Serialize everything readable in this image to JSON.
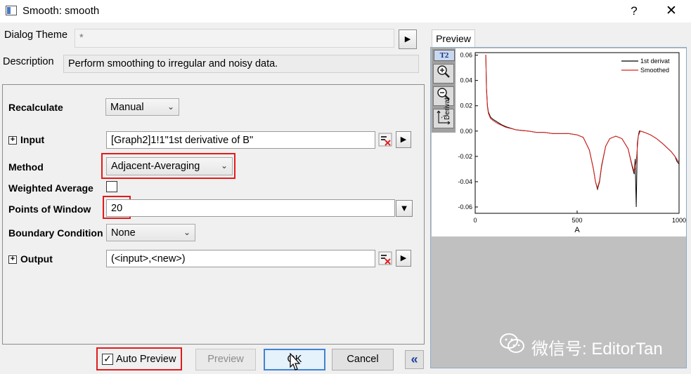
{
  "window": {
    "title": "Smooth: smooth",
    "help_label": "?",
    "close_label": "✕"
  },
  "header": {
    "theme_label": "Dialog Theme",
    "theme_value": "*",
    "description_label": "Description",
    "description_value": "Perform smoothing to irregular and noisy data."
  },
  "form": {
    "recalculate": {
      "label": "Recalculate",
      "value": "Manual"
    },
    "input": {
      "label": "Input",
      "value": "[Graph2]1!1\"1st derivative of B\""
    },
    "method": {
      "label": "Method",
      "value": "Adjacent-Averaging"
    },
    "weighted_average": {
      "label": "Weighted Average",
      "checked": false
    },
    "points_of_window": {
      "label": "Points of Window",
      "value": "20"
    },
    "boundary_condition": {
      "label": "Boundary Condition",
      "value": "None"
    },
    "output": {
      "label": "Output",
      "value": "(<input>,<new>)"
    }
  },
  "footer": {
    "auto_preview_label": "Auto Preview",
    "auto_preview_checked": true,
    "preview_button": "Preview",
    "ok_button": "OK",
    "cancel_button": "Cancel",
    "collapse_label": "«"
  },
  "preview": {
    "tab_label": "Preview",
    "layer_badge": "T2",
    "tools": [
      "zoom-in-icon",
      "zoom-out-icon",
      "rescale-icon"
    ]
  },
  "watermark": "微信号: EditorTan",
  "chart_data": {
    "type": "line",
    "xlabel": "A",
    "ylabel": "Derivat",
    "xlim": [
      0,
      1000
    ],
    "ylim": [
      -0.065,
      0.062
    ],
    "xticks": [
      "0",
      "500",
      "1000"
    ],
    "yticks": [
      "0.06",
      "0.04",
      "0.02",
      "0.00",
      "-0.02",
      "-0.04",
      "-0.06"
    ],
    "legend_position": "top-right",
    "series": [
      {
        "name": "1st derivat",
        "color": "#000000",
        "x": [
          50,
          52,
          55,
          60,
          65,
          75,
          90,
          110,
          130,
          150,
          180,
          200,
          230,
          260,
          300,
          340,
          380,
          420,
          460,
          500,
          530,
          560,
          580,
          590,
          600,
          610,
          620,
          640,
          660,
          690,
          720,
          750,
          770,
          780,
          785,
          790,
          795,
          800,
          805,
          810,
          830,
          860,
          890,
          920,
          940,
          960,
          980,
          990,
          1000
        ],
        "y": [
          0.06,
          0.06,
          0.035,
          0.02,
          0.015,
          0.011,
          0.009,
          0.007,
          0.005,
          0.0035,
          0.002,
          0.001,
          0.0005,
          0.0,
          -0.001,
          -0.001,
          -0.002,
          -0.002,
          -0.002,
          -0.003,
          -0.005,
          -0.015,
          -0.03,
          -0.04,
          -0.046,
          -0.04,
          -0.028,
          -0.012,
          -0.006,
          -0.004,
          -0.006,
          -0.014,
          -0.028,
          -0.034,
          -0.022,
          -0.06,
          -0.01,
          -0.004,
          0.0,
          0.0,
          -0.001,
          -0.003,
          -0.006,
          -0.01,
          -0.013,
          -0.016,
          -0.02,
          -0.024,
          -0.026
        ]
      },
      {
        "name": "Smoothed",
        "color": "#e0201b",
        "x": [
          50,
          52,
          55,
          60,
          65,
          75,
          90,
          110,
          130,
          150,
          180,
          200,
          230,
          260,
          300,
          340,
          380,
          420,
          460,
          500,
          530,
          560,
          580,
          590,
          600,
          610,
          620,
          640,
          660,
          690,
          720,
          750,
          770,
          780,
          790,
          800,
          810,
          830,
          860,
          890,
          920,
          940,
          960,
          980,
          1000
        ],
        "y": [
          0.06,
          0.06,
          0.033,
          0.019,
          0.014,
          0.01,
          0.008,
          0.006,
          0.0045,
          0.003,
          0.0018,
          0.001,
          0.0004,
          0.0,
          -0.001,
          -0.001,
          -0.002,
          -0.002,
          -0.002,
          -0.003,
          -0.005,
          -0.015,
          -0.03,
          -0.04,
          -0.045,
          -0.039,
          -0.027,
          -0.012,
          -0.006,
          -0.004,
          -0.006,
          -0.014,
          -0.027,
          -0.032,
          -0.024,
          -0.004,
          0.0,
          -0.001,
          -0.003,
          -0.006,
          -0.01,
          -0.013,
          -0.016,
          -0.02,
          -0.025
        ]
      }
    ]
  }
}
